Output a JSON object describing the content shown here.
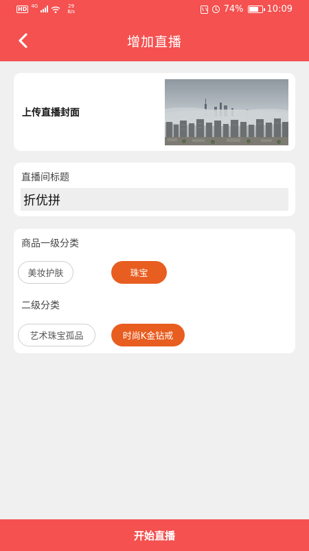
{
  "status_bar": {
    "hd": "HD",
    "network": "4G",
    "speed_value": "29",
    "speed_unit": "B/s",
    "battery": "74%",
    "time": "10:09",
    "battery_level": 0.74
  },
  "header": {
    "title": "增加直播",
    "back_icon": "chevron-left-icon"
  },
  "cover": {
    "label": "上传直播封面"
  },
  "title_field": {
    "label": "直播间标题",
    "value": "折优拼"
  },
  "category": {
    "level1_label": "商品一级分类",
    "level1_options": [
      {
        "label": "美妆护肤",
        "selected": false
      },
      {
        "label": "珠宝",
        "selected": true
      }
    ],
    "level2_label": "二级分类",
    "level2_options": [
      {
        "label": "艺术珠宝孤品",
        "selected": false
      },
      {
        "label": "时尚K金钻戒",
        "selected": true
      }
    ]
  },
  "footer": {
    "start_label": "开始直播"
  },
  "colors": {
    "primary": "#f45150",
    "chip_active": "#e85d20",
    "background": "#f0f0f0"
  }
}
